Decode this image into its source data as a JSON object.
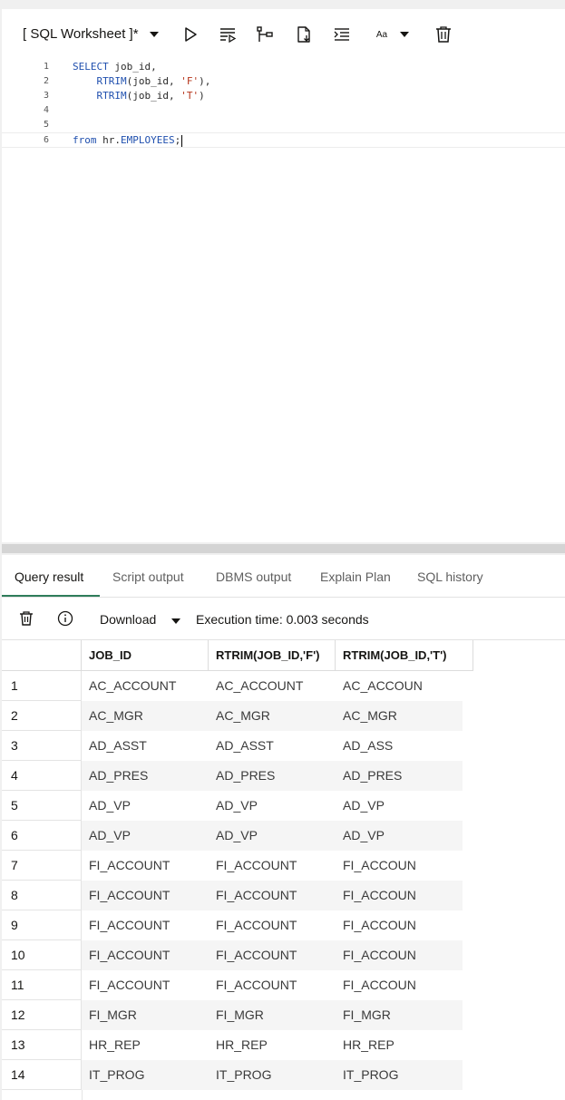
{
  "toolbar": {
    "title": "[ SQL Worksheet ]*",
    "font_label": "Aa"
  },
  "editor": {
    "lines": [
      {
        "num": "1",
        "segments": [
          {
            "t": "SELECT",
            "c": "kw"
          },
          {
            "t": " job_id,",
            "c": "ident"
          }
        ]
      },
      {
        "num": "2",
        "segments": [
          {
            "t": "    RTRIM",
            "c": "kw"
          },
          {
            "t": "(job_id, ",
            "c": "ident"
          },
          {
            "t": "'F'",
            "c": "str"
          },
          {
            "t": "),",
            "c": "ident"
          }
        ]
      },
      {
        "num": "3",
        "segments": [
          {
            "t": "    RTRIM",
            "c": "kw"
          },
          {
            "t": "(job_id, ",
            "c": "ident"
          },
          {
            "t": "'T'",
            "c": "str"
          },
          {
            "t": ")",
            "c": "ident"
          }
        ]
      },
      {
        "num": "4",
        "segments": []
      },
      {
        "num": "5",
        "segments": []
      },
      {
        "num": "6",
        "segments": [
          {
            "t": "from",
            "c": "kw"
          },
          {
            "t": " hr.",
            "c": "ident"
          },
          {
            "t": "EMPLOYEES",
            "c": "kw"
          },
          {
            "t": ";",
            "c": "ident"
          }
        ]
      }
    ]
  },
  "tabs": [
    {
      "label": "Query result",
      "active": true
    },
    {
      "label": "Script output",
      "active": false
    },
    {
      "label": "DBMS output",
      "active": false
    },
    {
      "label": "Explain Plan",
      "active": false
    },
    {
      "label": "SQL history",
      "active": false
    }
  ],
  "results_toolbar": {
    "download_label": "Download",
    "execution_time": "Execution time: 0.003 seconds"
  },
  "grid": {
    "columns": [
      "JOB_ID",
      "RTRIM(JOB_ID,'F')",
      "RTRIM(JOB_ID,'T')"
    ],
    "rows": [
      {
        "n": "1",
        "cells": [
          "AC_ACCOUNT",
          "AC_ACCOUNT",
          "AC_ACCOUN"
        ]
      },
      {
        "n": "2",
        "cells": [
          "AC_MGR",
          "AC_MGR",
          "AC_MGR"
        ]
      },
      {
        "n": "3",
        "cells": [
          "AD_ASST",
          "AD_ASST",
          "AD_ASS"
        ]
      },
      {
        "n": "4",
        "cells": [
          "AD_PRES",
          "AD_PRES",
          "AD_PRES"
        ]
      },
      {
        "n": "5",
        "cells": [
          "AD_VP",
          "AD_VP",
          "AD_VP"
        ]
      },
      {
        "n": "6",
        "cells": [
          "AD_VP",
          "AD_VP",
          "AD_VP"
        ]
      },
      {
        "n": "7",
        "cells": [
          "FI_ACCOUNT",
          "FI_ACCOUNT",
          "FI_ACCOUN"
        ]
      },
      {
        "n": "8",
        "cells": [
          "FI_ACCOUNT",
          "FI_ACCOUNT",
          "FI_ACCOUN"
        ]
      },
      {
        "n": "9",
        "cells": [
          "FI_ACCOUNT",
          "FI_ACCOUNT",
          "FI_ACCOUN"
        ]
      },
      {
        "n": "10",
        "cells": [
          "FI_ACCOUNT",
          "FI_ACCOUNT",
          "FI_ACCOUN"
        ]
      },
      {
        "n": "11",
        "cells": [
          "FI_ACCOUNT",
          "FI_ACCOUNT",
          "FI_ACCOUN"
        ]
      },
      {
        "n": "12",
        "cells": [
          "FI_MGR",
          "FI_MGR",
          "FI_MGR"
        ]
      },
      {
        "n": "13",
        "cells": [
          "HR_REP",
          "HR_REP",
          "HR_REP"
        ]
      },
      {
        "n": "14",
        "cells": [
          "IT_PROG",
          "IT_PROG",
          "IT_PROG"
        ]
      }
    ]
  },
  "colors": {
    "accent": "#2f7d5a",
    "keyword": "#1f4fae",
    "string": "#b5341a"
  },
  "icons": [
    "chevron-down-icon",
    "run-icon",
    "run-script-icon",
    "explain-plan-icon",
    "autotrace-icon",
    "format-icon",
    "font-size-icon",
    "trash-icon",
    "info-icon"
  ]
}
